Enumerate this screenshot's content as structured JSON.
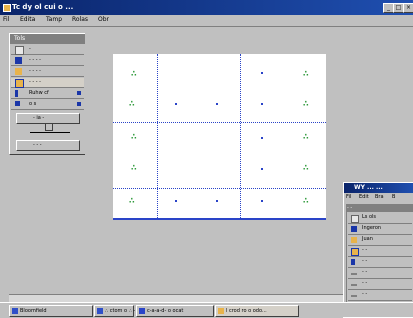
{
  "window": {
    "title": "Tc dy ol cui o ...",
    "controls": [
      "_",
      "□",
      "×"
    ]
  },
  "menu": [
    "Fil",
    "Edita",
    "Tamp",
    "Rolas",
    "Obr"
  ],
  "toolbox": {
    "title": "Tols",
    "items": [
      {
        "label": "-",
        "icon": "cursor-icon"
      },
      {
        "label": "- - - -",
        "icon": "blue-block-icon"
      },
      {
        "label": "- - - -",
        "icon": "pencil-icon"
      },
      {
        "label": "- - - -",
        "icon": "lines-icon"
      },
      {
        "label": "Ruhw cf",
        "icon": "line-icon"
      },
      {
        "label": "o s",
        "icon": "node-icon"
      }
    ],
    "option_label": "- ia -",
    "button_label": "- - -"
  },
  "canvas": {
    "symbols": [
      "∴",
      "∴",
      "∴",
      "∴",
      "∴",
      "∴",
      "∴",
      "∴",
      "∴",
      "∴"
    ]
  },
  "taskbar": {
    "tasks": [
      {
        "label": "Bloomfield",
        "color": "#3050c8"
      },
      {
        "label": "∴ ctom o ∴ - s -",
        "color": "#3050c8"
      },
      {
        "label": "c-a-a-d- o ocat",
        "color": "#2a44c8"
      },
      {
        "label": "l crod ro o odo...",
        "color": "#e8b34b"
      }
    ]
  },
  "subwindow": {
    "title": "WY ... ...",
    "menu": [
      "Fil",
      "Edit",
      "Bra",
      "B"
    ],
    "head": "- -",
    "items": [
      {
        "label": "Ls ols",
        "icon": "arrow-icon"
      },
      {
        "label": "Ingeron",
        "icon": "blue-block-icon"
      },
      {
        "label": "Juan",
        "icon": "pencil-icon"
      },
      {
        "label": "- -",
        "icon": "lines-icon"
      },
      {
        "label": "- -",
        "icon": "node-icon"
      },
      {
        "label": "- -",
        "icon": "line-icon"
      },
      {
        "label": "- -",
        "icon": "line-icon"
      },
      {
        "label": "- -",
        "icon": "line-icon"
      }
    ]
  }
}
